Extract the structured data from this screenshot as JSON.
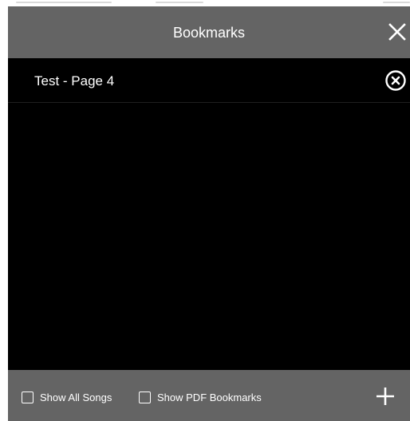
{
  "dialog": {
    "title": "Bookmarks",
    "close_icon": "close-icon"
  },
  "bookmarks": [
    {
      "label": "Test - Page 4",
      "delete_icon": "circle-x-icon"
    }
  ],
  "footer": {
    "show_all_songs": {
      "label": "Show All Songs",
      "checked": false
    },
    "show_pdf_bookmarks": {
      "label": "Show PDF Bookmarks",
      "checked": false
    },
    "add_icon": "plus-icon"
  },
  "colors": {
    "header_bg": "#646464",
    "list_bg": "#000000",
    "text": "#ffffff"
  }
}
